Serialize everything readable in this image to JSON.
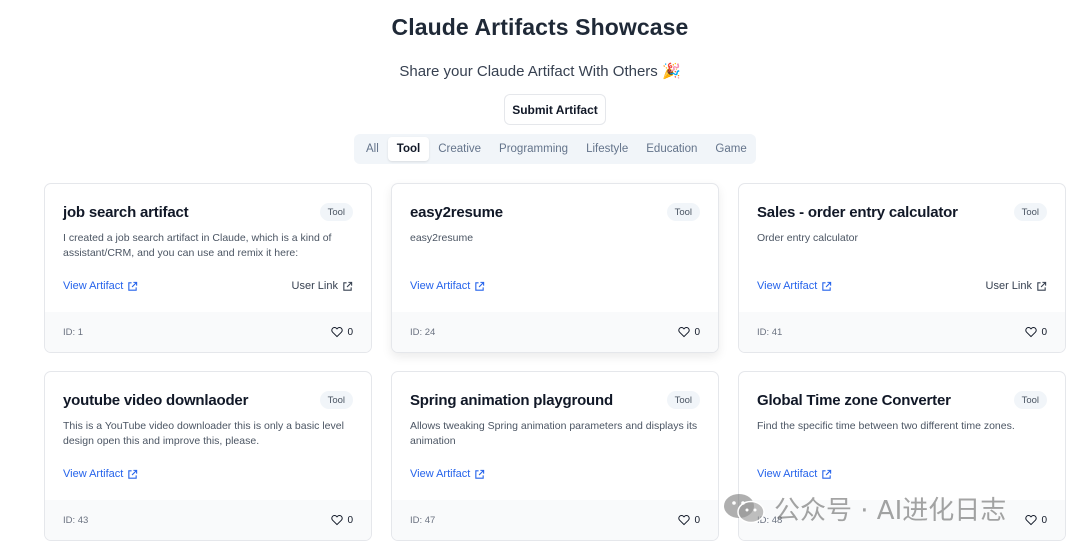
{
  "header": {
    "title": "Claude Artifacts Showcase",
    "subtitle": "Share your Claude Artifact With Others 🎉",
    "submit_label": "Submit Artifact"
  },
  "tabs": [
    {
      "label": "All",
      "active": false
    },
    {
      "label": "Tool",
      "active": true
    },
    {
      "label": "Creative",
      "active": false
    },
    {
      "label": "Programming",
      "active": false
    },
    {
      "label": "Lifestyle",
      "active": false
    },
    {
      "label": "Education",
      "active": false
    },
    {
      "label": "Game",
      "active": false
    }
  ],
  "cards": [
    {
      "title": "job search artifact",
      "badge": "Tool",
      "description": "I created a job search artifact in Claude, which is a kind of assistant/CRM, and you can use and remix it here:",
      "view_label": "View Artifact",
      "user_link_label": "User Link",
      "id_label": "ID: 1",
      "likes": "0"
    },
    {
      "title": "easy2resume",
      "badge": "Tool",
      "description": "easy2resume",
      "view_label": "View Artifact",
      "user_link_label": "",
      "id_label": "ID: 24",
      "likes": "0"
    },
    {
      "title": "Sales - order entry calculator",
      "badge": "Tool",
      "description": "Order entry calculator",
      "view_label": "View Artifact",
      "user_link_label": "User Link",
      "id_label": "ID: 41",
      "likes": "0"
    },
    {
      "title": "youtube video downlaoder",
      "badge": "Tool",
      "description": "This is a YouTube video downloader this is only a basic level design open this and improve this, please.",
      "view_label": "View Artifact",
      "user_link_label": "",
      "id_label": "ID: 43",
      "likes": "0"
    },
    {
      "title": "Spring animation playground",
      "badge": "Tool",
      "description": "Allows tweaking Spring animation parameters and displays its animation",
      "view_label": "View Artifact",
      "user_link_label": "",
      "id_label": "ID: 47",
      "likes": "0"
    },
    {
      "title": "Global Time zone Converter",
      "badge": "Tool",
      "description": "Find the specific time between two different time zones.",
      "view_label": "View Artifact",
      "user_link_label": "",
      "id_label": "ID: 48",
      "likes": "0"
    }
  ],
  "watermark": {
    "text": "公众号 · AI进化日志",
    "icon": "wechat-icon"
  },
  "colors": {
    "link": "#2563eb",
    "badge_bg": "#f1f5f9",
    "tab_bg": "#f1f5f9",
    "footer_bg": "#f9fafb"
  }
}
